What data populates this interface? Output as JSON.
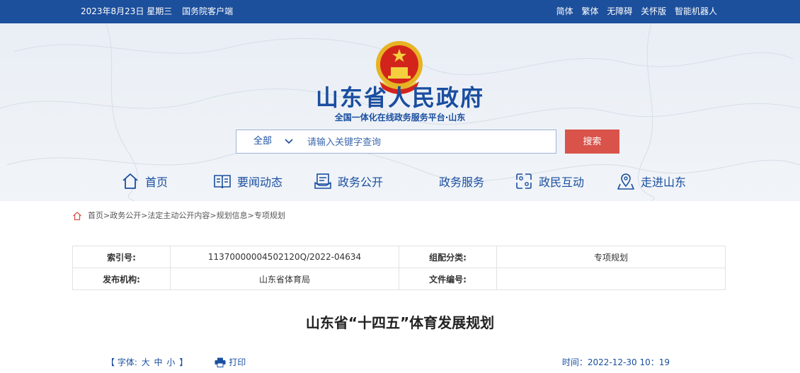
{
  "topbar": {
    "date": "2023年8月23日 星期三",
    "client": "国务院客户端",
    "links": [
      "简体",
      "繁体",
      "无障碍",
      "关怀版",
      "智能机器人"
    ]
  },
  "header": {
    "title": "山东省人民政府",
    "subtitle": "全国一体化在线政务服务平台·山东"
  },
  "search": {
    "scope": "全部",
    "placeholder": "请输入关键字查询",
    "button": "搜索"
  },
  "nav": [
    {
      "label": "首页",
      "icon": "home-icon"
    },
    {
      "label": "要闻动态",
      "icon": "book-icon"
    },
    {
      "label": "政务公开",
      "icon": "document-icon"
    },
    {
      "label": "政务服务",
      "icon": ""
    },
    {
      "label": "政民互动",
      "icon": "interaction-icon"
    },
    {
      "label": "走进山东",
      "icon": "location-icon"
    }
  ],
  "breadcrumb": "首页>政务公开>法定主动公开内容>规划信息>专项规划",
  "meta": {
    "index_label": "索引号:",
    "index_value": "11370000004502120Q/2022-04634",
    "category_label": "组配分类:",
    "category_value": "专项规划",
    "publisher_label": "发布机构:",
    "publisher_value": "山东省体育局",
    "docno_label": "文件编号:",
    "docno_value": ""
  },
  "doc_title": "山东省“十四五”体育发展规划",
  "tools": {
    "font_prefix": "【 字体:",
    "font_large": "大",
    "font_medium": "中",
    "font_small": "小",
    "font_suffix": "】",
    "print": "打印"
  },
  "time": "时间：2022-12-30 10：19",
  "colors": {
    "topbar": "#1c4f9c",
    "brand": "#1a4ea0",
    "search_button": "#d9534a"
  }
}
